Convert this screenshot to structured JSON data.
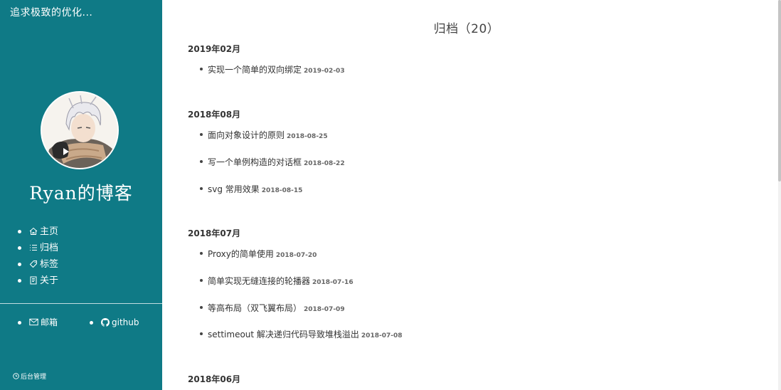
{
  "sidebar": {
    "motto": "追求极致的优化...",
    "blog_title": "Ryan的博客",
    "nav": [
      {
        "label": "主页",
        "icon": "home-icon"
      },
      {
        "label": "归档",
        "icon": "list-icon"
      },
      {
        "label": "标签",
        "icon": "tag-icon"
      },
      {
        "label": "关于",
        "icon": "book-icon"
      }
    ],
    "social": [
      {
        "label": "邮箱",
        "icon": "mail-icon"
      },
      {
        "label": "github",
        "icon": "github-icon"
      }
    ],
    "admin_label": "后台管理",
    "background_color": "#0f7a86"
  },
  "archive": {
    "title": "归档（20）",
    "groups": [
      {
        "month": "2019年02月",
        "posts": [
          {
            "title": "实现一个简单的双向绑定",
            "date": "2019-02-03"
          }
        ]
      },
      {
        "month": "2018年08月",
        "posts": [
          {
            "title": "面向对象设计的原则",
            "date": "2018-08-25"
          },
          {
            "title": "写一个单例构造的对话框",
            "date": "2018-08-22"
          },
          {
            "title": "svg 常用效果",
            "date": "2018-08-15"
          }
        ]
      },
      {
        "month": "2018年07月",
        "posts": [
          {
            "title": "Proxy的简单使用",
            "date": "2018-07-20"
          },
          {
            "title": "简单实现无缝连接的轮播器",
            "date": "2018-07-16"
          },
          {
            "title": "等高布局（双飞翼布局）",
            "date": "2018-07-09"
          },
          {
            "title": "settimeout 解决递归代码导致堆栈溢出",
            "date": "2018-07-08"
          }
        ]
      },
      {
        "month": "2018年06月",
        "posts": []
      }
    ]
  }
}
